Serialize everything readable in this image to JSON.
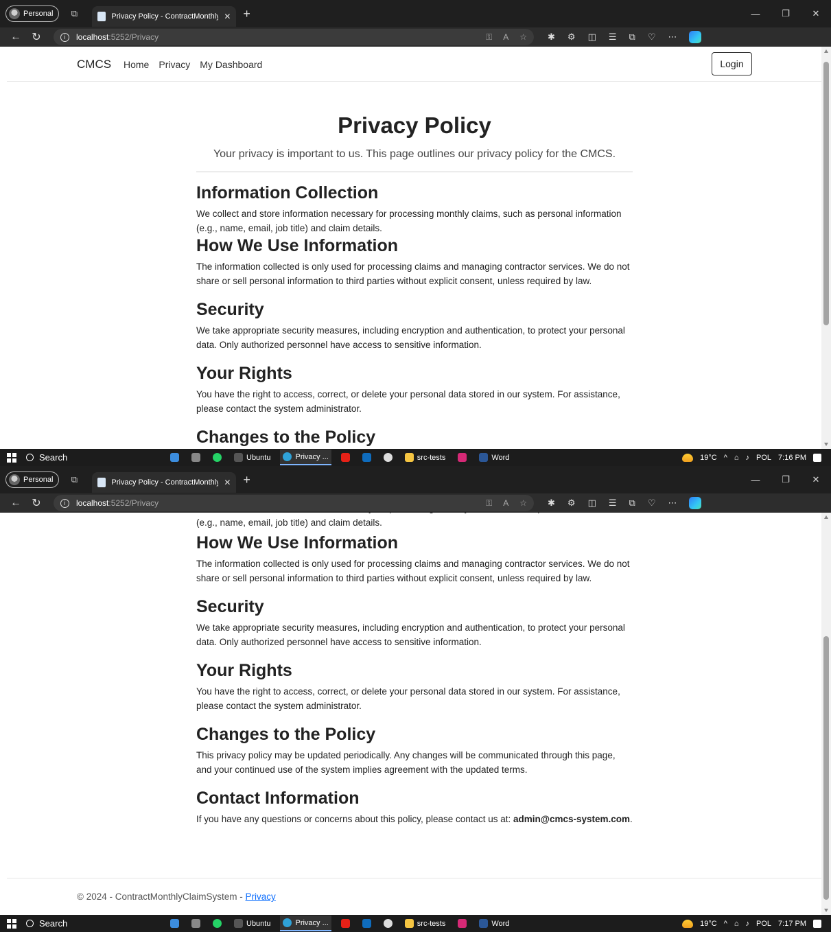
{
  "browser": {
    "profile_label": "Personal",
    "tab_title": "Privacy Policy - ContractMonthlyC",
    "url_host": "localhost",
    "url_path": ":5252/Privacy"
  },
  "site": {
    "brand": "CMCS",
    "nav": [
      "Home",
      "Privacy",
      "My Dashboard"
    ],
    "login_label": "Login"
  },
  "page": {
    "title": "Privacy Policy",
    "lead": "Your privacy is important to us. This page outlines our privacy policy for the CMCS.",
    "sections": [
      {
        "heading": "Information Collection",
        "body": "We collect and store information necessary for processing monthly claims, such as personal information (e.g., name, email, job title) and claim details."
      },
      {
        "heading": "How We Use Information",
        "body": "The information collected is only used for processing claims and managing contractor services. We do not share or sell personal information to third parties without explicit consent, unless required by law."
      },
      {
        "heading": "Security",
        "body": "We take appropriate security measures, including encryption and authentication, to protect your personal data. Only authorized personnel have access to sensitive information."
      },
      {
        "heading": "Your Rights",
        "body": "You have the right to access, correct, or delete your personal data stored in our system. For assistance, please contact the system administrator."
      },
      {
        "heading": "Changes to the Policy",
        "body": "This privacy policy may be updated periodically. Any changes will be communicated through this page, and your continued use of the system implies agreement with the updated terms."
      }
    ],
    "contact": {
      "heading": "Contact Information",
      "body_prefix": "If you have any questions or concerns about this policy, please contact us at: ",
      "email": "admin@cmcs-system.com",
      "body_suffix": "."
    }
  },
  "footer": {
    "text": "© 2024 - ContractMonthlyClaimSystem - ",
    "link": "Privacy"
  },
  "taskbar": {
    "search": "Search",
    "apps": [
      "Ubuntu",
      "Privacy ...",
      "src-tests",
      "Word"
    ],
    "temperature": "19°C",
    "language": "POL",
    "time_1": "7:16 PM",
    "time_2": "7:17 PM"
  },
  "colors": {
    "link": "#0d6efd",
    "chrome_dark": "#1f1f1f",
    "taskbar": "#1c1c1c"
  }
}
